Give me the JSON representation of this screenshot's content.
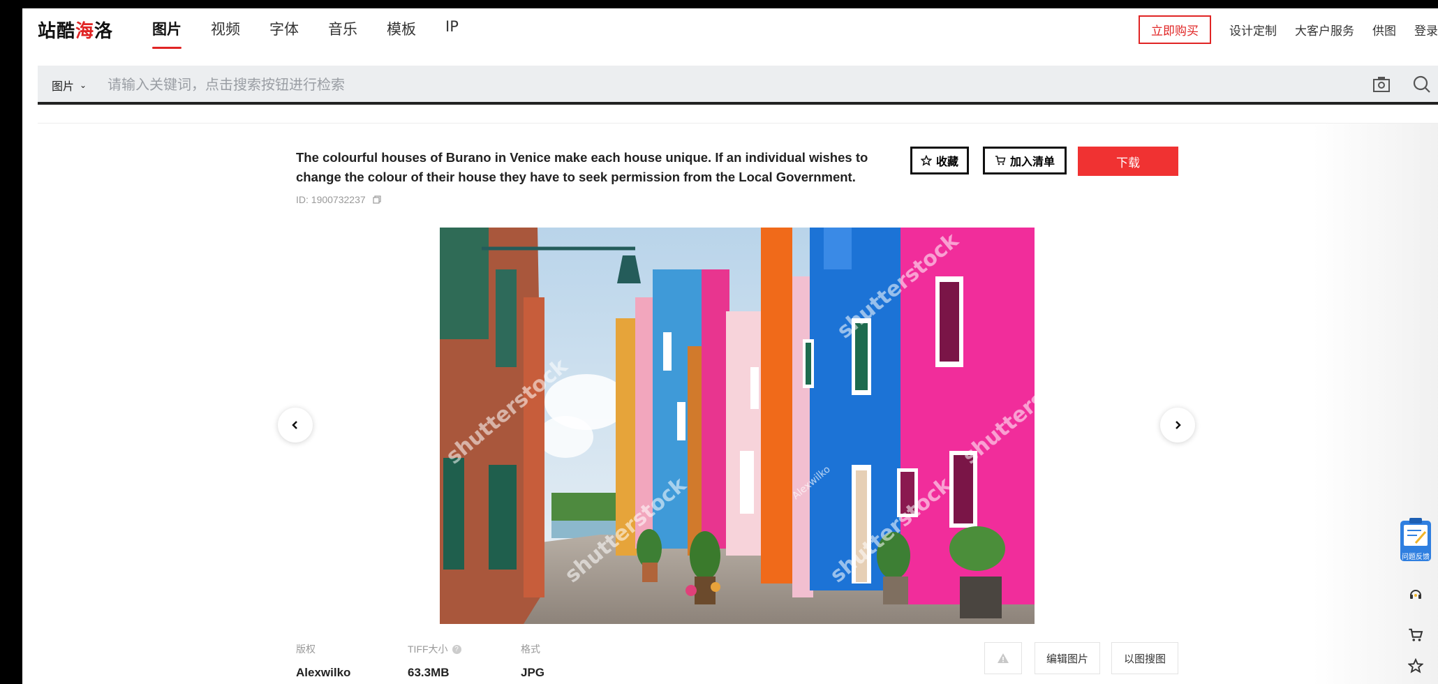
{
  "logo": {
    "part1": "站酷",
    "part2": "海",
    "part3": "洛"
  },
  "nav": {
    "tabs": [
      {
        "label": "图片",
        "active": true
      },
      {
        "label": "视频"
      },
      {
        "label": "字体"
      },
      {
        "label": "音乐"
      },
      {
        "label": "模板"
      },
      {
        "label": "IP"
      }
    ],
    "buy_now": "立即购买",
    "links": [
      "设计定制",
      "大客户服务",
      "供图",
      "登录"
    ]
  },
  "search": {
    "scope": "图片",
    "placeholder": "请输入关键词，点击搜索按钮进行检索",
    "value": ""
  },
  "detail": {
    "description": "The colourful houses of Burano in Venice make each house unique. If an individual wishes to change the colour of their house they have to seek permission from the Local Government.",
    "id_text": "ID: 1900732237",
    "favorite_label": "收藏",
    "add_to_list_label": "加入清单",
    "download_label": "下载"
  },
  "photo": {
    "watermark": "shutterstock",
    "author_tag": "Alexwilko"
  },
  "meta": {
    "copyright_label": "版权",
    "copyright_value": "Alexwilko",
    "size_label": "TIFF大小",
    "size_value": "63.3MB",
    "format_label": "格式",
    "format_value": "JPG"
  },
  "actions": {
    "edit_label": "编辑图片",
    "search_by_image_label": "以图搜图"
  },
  "sidebar": {
    "feedback_label": "问题反馈"
  },
  "colors": {
    "accent": "#e02424",
    "download_bg": "#f03232"
  }
}
